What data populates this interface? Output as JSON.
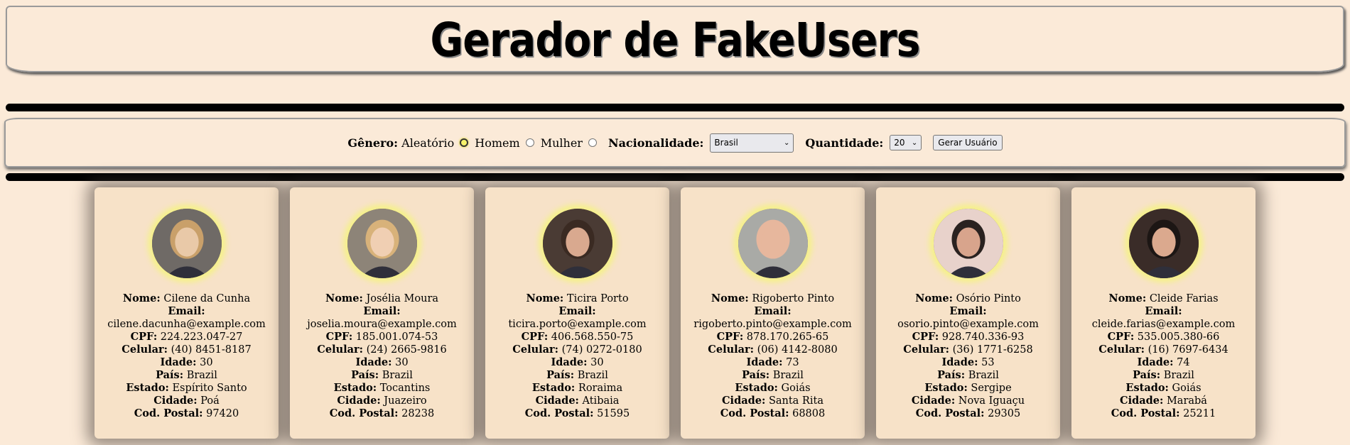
{
  "title": "Gerador de FakeUsers",
  "form": {
    "genero_label": "Gênero:",
    "options": [
      "Aleatório",
      "Homem",
      "Mulher"
    ],
    "selected": "Aleatório",
    "nacionalidade_label": "Nacionalidade:",
    "nacionalidade_value": "Brasil",
    "quantidade_label": "Quantidade:",
    "quantidade_value": "20",
    "button_label": "Gerar Usuário"
  },
  "labels": {
    "nome": "Nome:",
    "email": "Email:",
    "cpf": "CPF:",
    "celular": "Celular:",
    "idade": "Idade:",
    "pais": "País:",
    "estado": "Estado:",
    "cidade": "Cidade:",
    "cep": "Cod. Postal:"
  },
  "users": [
    {
      "nome": "Cilene da Cunha",
      "email": "cilene.dacunha@example.com",
      "cpf": "224.223.047-27",
      "celular": "(40) 8451-8187",
      "idade": "30",
      "pais": "Brazil",
      "estado": "Espírito Santo",
      "cidade": "Poá",
      "cep": "97420",
      "skin": "#e9c9a8",
      "hair": "#c9a06a",
      "bg": "#6f6a66"
    },
    {
      "nome": "Josélia Moura",
      "email": "joselia.moura@example.com",
      "cpf": "185.001.074-53",
      "celular": "(24) 2665-9816",
      "idade": "30",
      "pais": "Brazil",
      "estado": "Tocantins",
      "cidade": "Juazeiro",
      "cep": "28238",
      "skin": "#f0cfb3",
      "hair": "#d8b27a",
      "bg": "#8d8478"
    },
    {
      "nome": "Ticira Porto",
      "email": "ticira.porto@example.com",
      "cpf": "406.568.550-75",
      "celular": "(74) 0272-0180",
      "idade": "30",
      "pais": "Brazil",
      "estado": "Roraima",
      "cidade": "Atibaia",
      "cep": "51595",
      "skin": "#d9a98f",
      "hair": "#3a2a22",
      "bg": "#4a3b34"
    },
    {
      "nome": "Rigoberto Pinto",
      "email": "rigoberto.pinto@example.com",
      "cpf": "878.170.265-65",
      "celular": "(06) 4142-8080",
      "idade": "73",
      "pais": "Brazil",
      "estado": "Goiás",
      "cidade": "Santa Rita",
      "cep": "68808",
      "skin": "#e7b79d",
      "hair": "#e7b79d",
      "bg": "#a9aaa6"
    },
    {
      "nome": "Osório Pinto",
      "email": "osorio.pinto@example.com",
      "cpf": "928.740.336-93",
      "celular": "(36) 1771-6258",
      "idade": "53",
      "pais": "Brazil",
      "estado": "Sergipe",
      "cidade": "Nova Iguaçu",
      "cep": "29305",
      "skin": "#d8a48c",
      "hair": "#2a2220",
      "bg": "#e8d2cb"
    },
    {
      "nome": "Cleide Farias",
      "email": "cleide.farias@example.com",
      "cpf": "535.005.380-66",
      "celular": "(16) 7697-6434",
      "idade": "74",
      "pais": "Brazil",
      "estado": "Goiás",
      "cidade": "Marabá",
      "cep": "25211",
      "skin": "#dba98e",
      "hair": "#1c1614",
      "bg": "#3a2c28"
    }
  ]
}
